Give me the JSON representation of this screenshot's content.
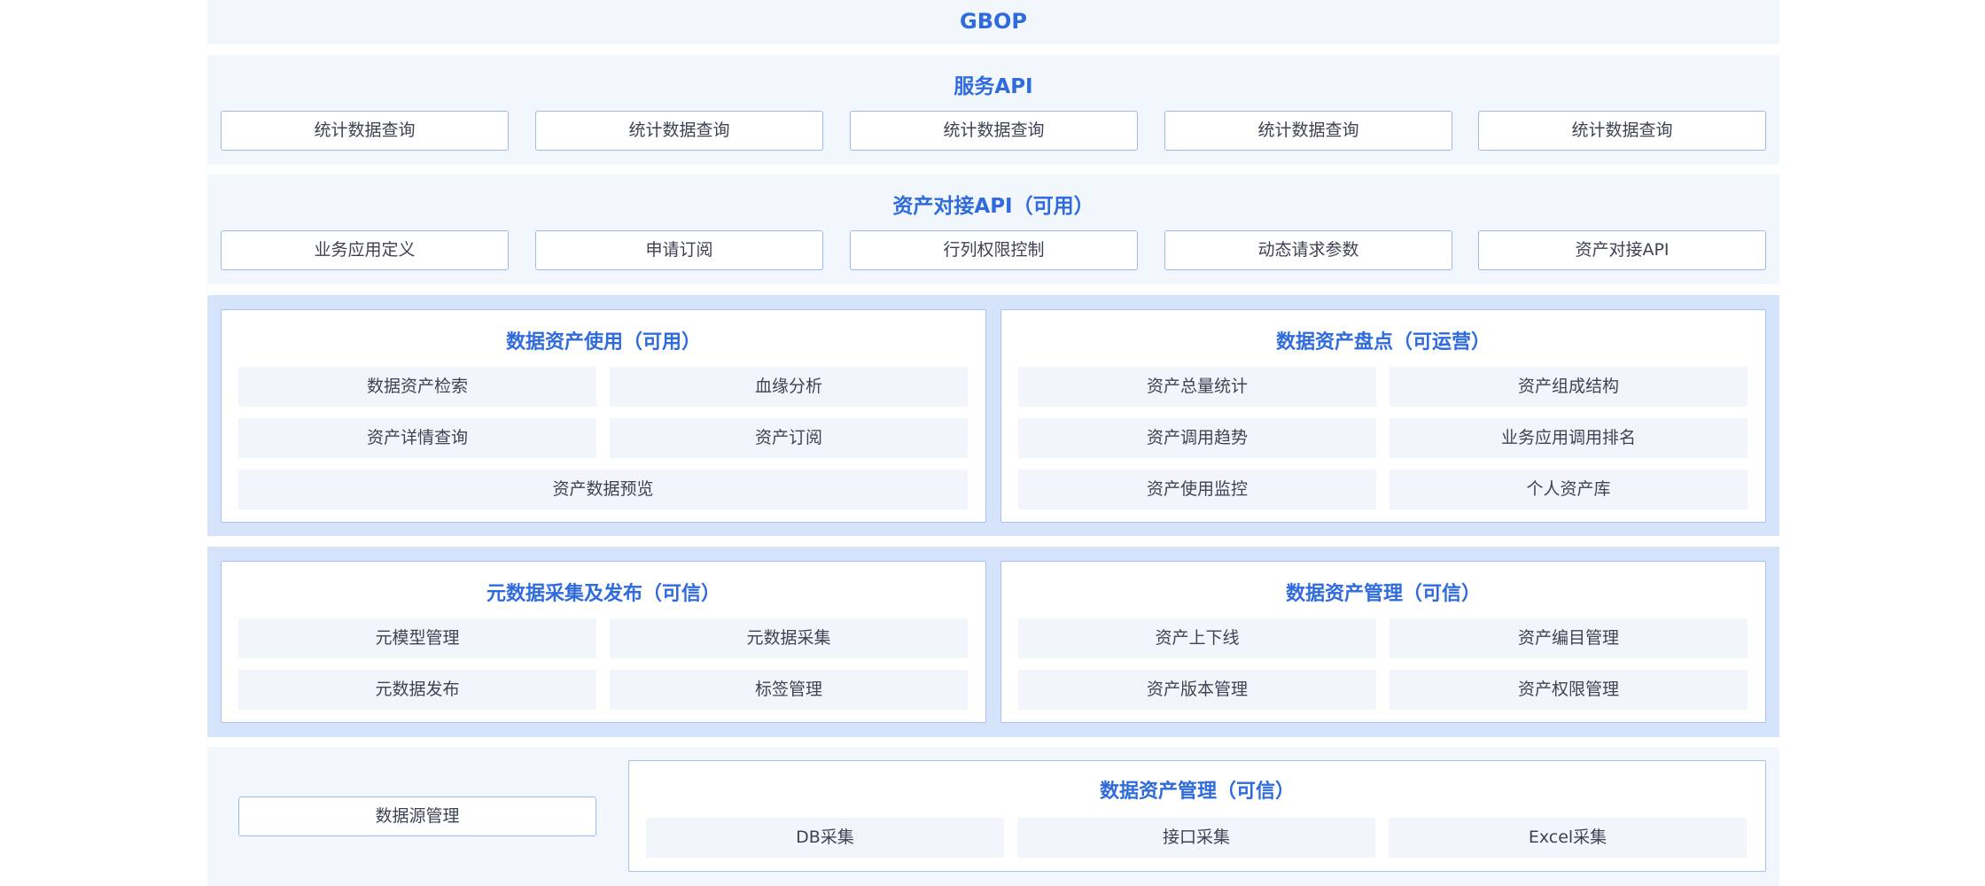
{
  "gbop": {
    "title": "GBOP"
  },
  "service_api": {
    "title": "服务API",
    "items": [
      "统计数据查询",
      "统计数据查询",
      "统计数据查询",
      "统计数据查询",
      "统计数据查询"
    ]
  },
  "asset_api": {
    "title": "资产对接API（可用）",
    "items": [
      "业务应用定义",
      "申请订阅",
      "行列权限控制",
      "动态请求参数",
      "资产对接API"
    ]
  },
  "asset_use": {
    "title": "数据资产使用（可用）",
    "items": [
      "数据资产检索",
      "血缘分析",
      "资产详情查询",
      "资产订阅",
      "资产数据预览"
    ]
  },
  "asset_inventory": {
    "title": "数据资产盘点（可运营）",
    "items": [
      "资产总量统计",
      "资产组成结构",
      "资产调用趋势",
      "业务应用调用排名",
      "资产使用监控",
      "个人资产库"
    ]
  },
  "metadata": {
    "title": "元数据采集及发布（可信）",
    "items": [
      "元模型管理",
      "元数据采集",
      "元数据发布",
      "标签管理"
    ]
  },
  "asset_mgmt": {
    "title": "数据资产管理（可信）",
    "items": [
      "资产上下线",
      "资产编目管理",
      "资产版本管理",
      "资产权限管理"
    ]
  },
  "datasource": {
    "label": "数据源管理"
  },
  "collection": {
    "title": "数据资产管理（可信）",
    "items": [
      "DB采集",
      "接口采集",
      "Excel采集"
    ]
  },
  "colors": {
    "title_blue": "#2f6bdc",
    "band_light": "#f2f7fe",
    "band_strong": "#d5e3fb",
    "border_blue": "#9db8ee",
    "cell_bg": "#f2f6fc"
  }
}
